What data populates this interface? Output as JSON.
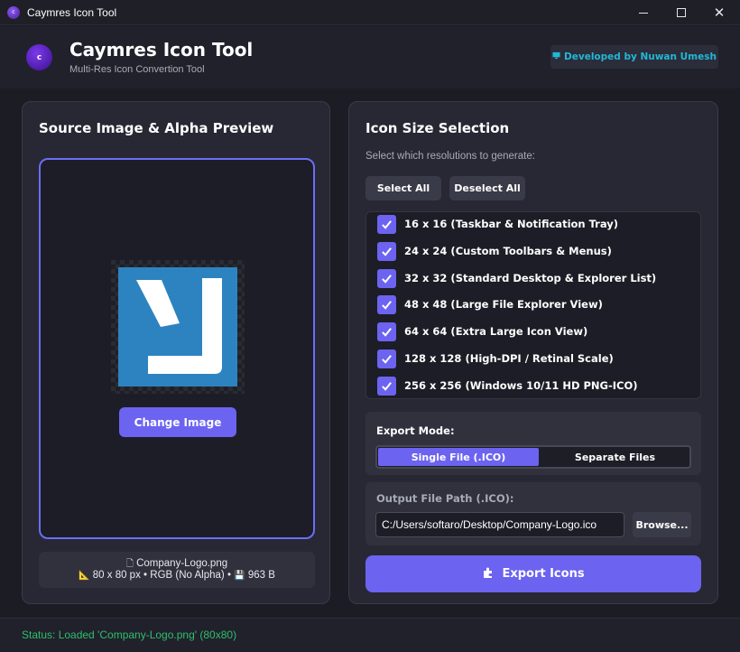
{
  "window": {
    "title": "Caymres Icon Tool",
    "icon_letter": "c"
  },
  "header": {
    "logo_letter": "c",
    "title": "Caymres Icon Tool",
    "subtitle": "Multi-Res Icon Convertion Tool",
    "developer_badge": "Developed by Nuwan Umesh"
  },
  "source_panel": {
    "heading": "Source Image & Alpha Preview",
    "change_image_label": "Change Image",
    "file_name": "Company-Logo.png",
    "dimensions": "80 x 80 px",
    "color_mode": "RGB (No Alpha)",
    "file_size": "963 B",
    "separator": "•"
  },
  "size_panel": {
    "heading": "Icon Size Selection",
    "hint": "Select which resolutions to generate:",
    "select_all_label": "Select All",
    "deselect_all_label": "Deselect All",
    "sizes": [
      {
        "label": "16 x 16 (Taskbar & Notification Tray)",
        "checked": true
      },
      {
        "label": "24 x 24 (Custom Toolbars & Menus)",
        "checked": true
      },
      {
        "label": "32 x 32 (Standard Desktop & Explorer List)",
        "checked": true
      },
      {
        "label": "48 x 48 (Large File Explorer View)",
        "checked": true
      },
      {
        "label": "64 x 64 (Extra Large Icon View)",
        "checked": true
      },
      {
        "label": "128 x 128 (High-DPI / Retinal Scale)",
        "checked": true
      },
      {
        "label": "256 x 256 (Windows 10/11 HD PNG-ICO)",
        "checked": true
      }
    ],
    "export_mode": {
      "label": "Export Mode:",
      "options": [
        "Single File (.ICO)",
        "Separate Files"
      ],
      "selected": "Single File (.ICO)"
    },
    "output_path": {
      "label": "Output File Path (.ICO):",
      "value": "C:/Users/softaro/Desktop/Company-Logo.ico",
      "browse_label": "Browse..."
    },
    "export_button_label": "Export Icons"
  },
  "status": {
    "text": "Status: Loaded 'Company-Logo.png' (80x80)"
  },
  "colors": {
    "accent": "#6c63f0",
    "background": "#1b1c24",
    "card": "#272834",
    "badge_text": "#22b8d6",
    "status_text": "#2fbf6d",
    "logo_blue": "#2d83c0"
  }
}
